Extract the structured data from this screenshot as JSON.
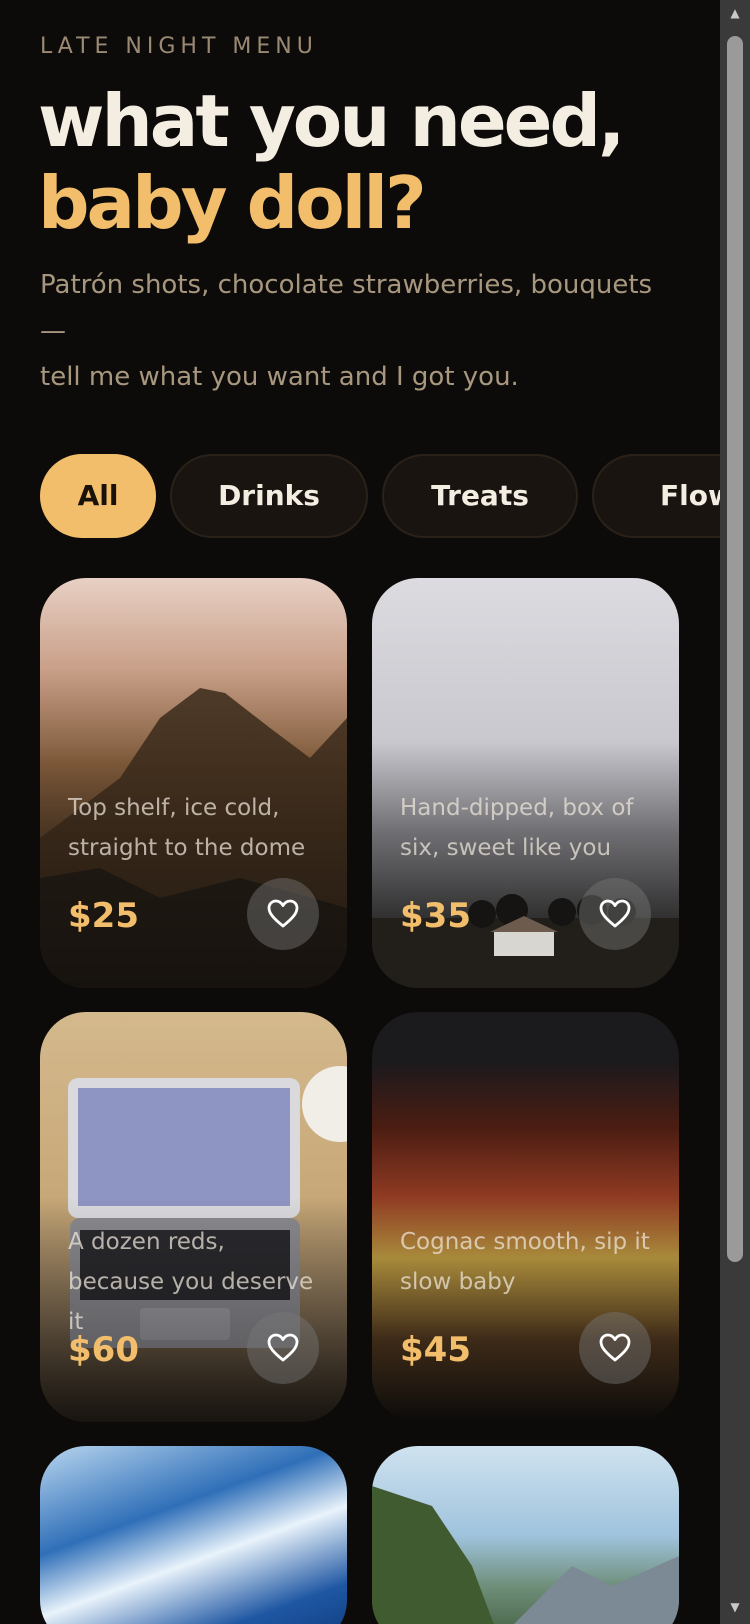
{
  "header": {
    "eyebrow": "LATE NIGHT MENU",
    "title_line1": "what you need,",
    "title_line2": "baby doll?",
    "subtitle_line1": "Patrón shots, chocolate strawberries, bouquets —",
    "subtitle_line2": "tell me what you want and I got you."
  },
  "filters": [
    {
      "label": "All",
      "active": true
    },
    {
      "label": "Drinks",
      "active": false
    },
    {
      "label": "Treats",
      "active": false
    },
    {
      "label": "Flowers",
      "active": false
    }
  ],
  "products": [
    {
      "description": "Top shelf, ice cold, straight to the dome",
      "price": "$25",
      "icon": "heart-outline-icon"
    },
    {
      "description": "Hand-dipped, box of six, sweet like you",
      "price": "$35",
      "icon": "heart-outline-icon"
    },
    {
      "description": "A dozen reds, because you deserve it",
      "price": "$60",
      "icon": "heart-outline-icon"
    },
    {
      "description": "Cognac smooth, sip it slow baby",
      "price": "$45",
      "icon": "heart-outline-icon"
    }
  ],
  "colors": {
    "background": "#0d0b09",
    "accent": "#f2be6b",
    "title": "#f3ede2",
    "muted": "#a8977f"
  }
}
